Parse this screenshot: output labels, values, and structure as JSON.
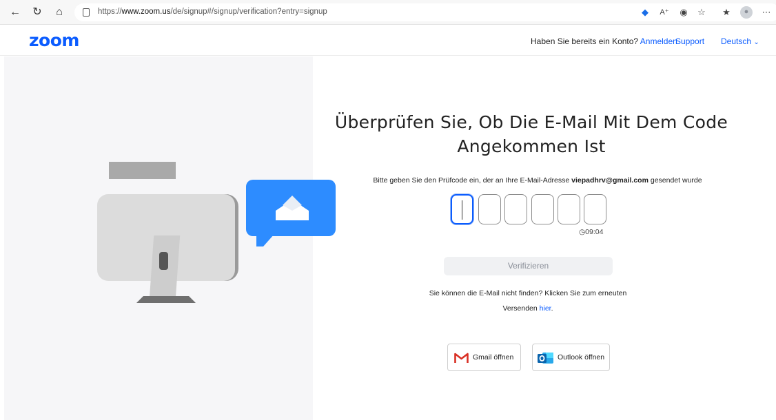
{
  "browser": {
    "url_prefix": "https://",
    "url_host": "www.zoom.us",
    "url_path": "/de/signup#/signup/verification?entry=signup"
  },
  "header": {
    "logo": "zoom",
    "account_question": "Haben Sie bereits ein Konto?",
    "signin_link": "Anmelden",
    "support_link": "Support",
    "language": "Deutsch"
  },
  "main": {
    "title_line1": "Überprüfen Sie, Ob Die E-Mail Mit Dem Code",
    "title_line2": "Angekommen Ist",
    "instruction_prefix": "Bitte geben Sie den Prüfcode ein, der an Ihre E-Mail-Adresse",
    "email": "viepadhrv@gmail.com",
    "instruction_suffix": "gesendet wurde",
    "timer": "09:04",
    "verify_button": "Verifizieren",
    "resend_text": "Sie können die E-Mail nicht finden? Klicken Sie zum erneuten",
    "resend_text2": "Versenden",
    "resend_link": "hier",
    "gmail_button": "Gmail öffnen",
    "outlook_button": "Outlook öffnen"
  },
  "colors": {
    "brand": "#0b5cff",
    "bubble": "#2d8cff"
  }
}
